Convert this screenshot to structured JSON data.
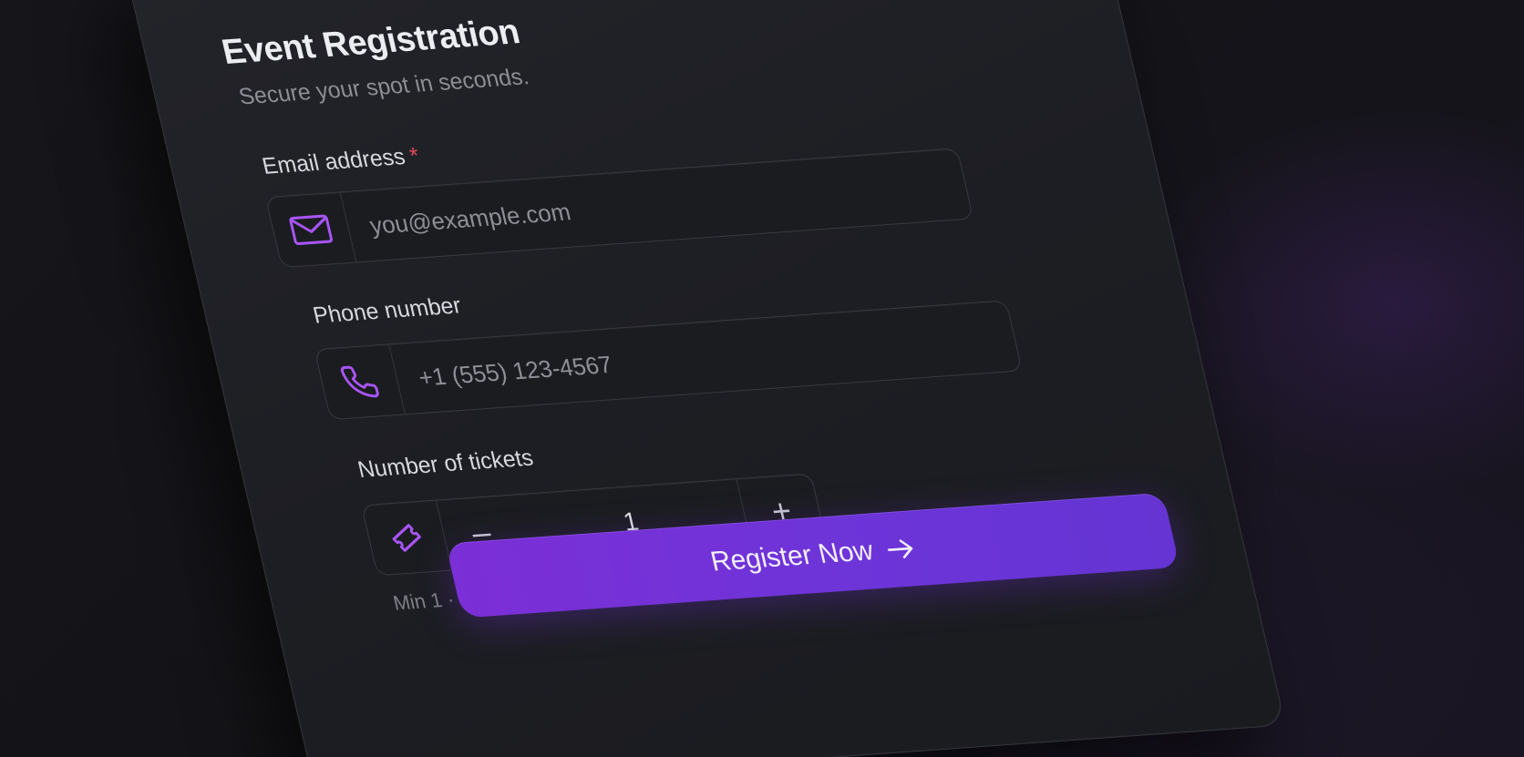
{
  "form": {
    "title": "Event Registration",
    "subtitle": "Secure your spot in seconds."
  },
  "email": {
    "label": "Email address",
    "required_mark": "*",
    "placeholder": "you@example.com",
    "icon": "mail-icon"
  },
  "phone": {
    "label": "Phone number",
    "placeholder": "+1 (555) 123-4567",
    "icon": "phone-icon"
  },
  "tickets": {
    "label": "Number of tickets",
    "icon": "ticket-icon",
    "decrement": "–",
    "increment": "+",
    "value": "1",
    "hint": "Min 1 · Max 10"
  },
  "submit": {
    "label": "Register Now",
    "icon": "arrow-right-icon"
  },
  "colors": {
    "accent": "#7b2fd6",
    "icon_accent": "#a855f7",
    "required": "#e04a5a",
    "card_bg": "#1f2025",
    "page_bg": "#141418"
  }
}
